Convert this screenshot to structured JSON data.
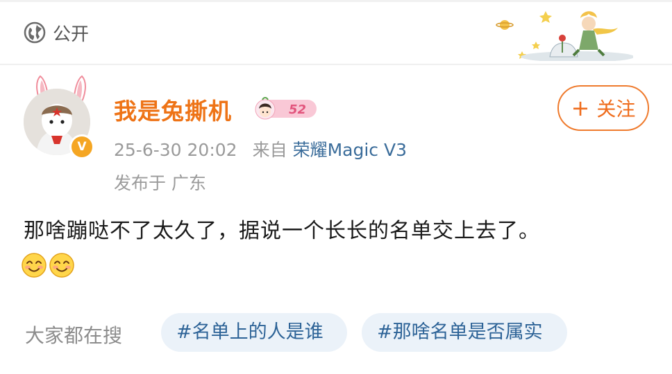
{
  "header": {
    "visibility_label": "公开",
    "visibility_icon": "globe-icon"
  },
  "author": {
    "name": "我是兔撕机",
    "level_badge": "52",
    "verified_icon": "verified-v-icon",
    "verified_text": "V"
  },
  "post_meta": {
    "timestamp": "25-6-30 20:02",
    "from_label": "来自",
    "device": "荣耀Magic V3",
    "location": "发布于 广东"
  },
  "follow_button": {
    "label": "关注",
    "icon": "plus-icon",
    "icon_text": "+"
  },
  "post": {
    "text": "那啥蹦哒不了太久了，据说一个长长的名单交上去了。",
    "emojis": [
      "smile-emoji",
      "smile-emoji"
    ]
  },
  "trending": {
    "title": "大家都在搜",
    "tags": [
      "#名单上的人是谁",
      "#那啥名单是否属实"
    ]
  },
  "colors": {
    "username": "#ee7316",
    "device_link": "#3a6c9a",
    "follow_border": "#ef7a2c",
    "tag_bg": "#ebf2f9",
    "tag_text": "#2d6397",
    "verified": "#f5a623"
  }
}
